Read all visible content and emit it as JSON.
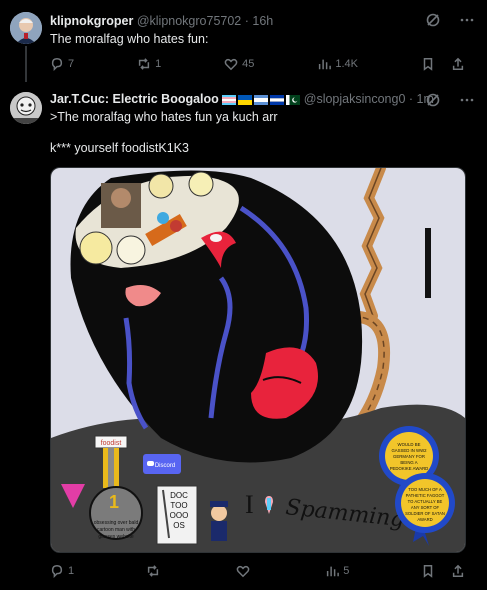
{
  "post1": {
    "name": "klipnokgroper",
    "handle": "@klipnokgro75702",
    "time": "16h",
    "text": "The moralfag who hates fun:",
    "replies": "7",
    "reposts": "1",
    "likes": "45",
    "views": "1.4K"
  },
  "post2": {
    "name": "Jar.T.Cuc: Electric Boogaloo",
    "handle": "@slopjaksincong0",
    "time": "1m",
    "line1": ">The moralfag who hates fun ya kuch arr",
    "line2": "k*** yourself foodistK1K3",
    "replies": "1",
    "reposts": "",
    "likes": "",
    "views": "5"
  },
  "image": {
    "label_foodist": "foodist",
    "label_discord": "Discord",
    "medal_text": "obsessing over bald cartoon man with glasses website",
    "medal_number": "1",
    "doc_text": "DOC TOO OOO OS",
    "spamming_text": "Spamming 'p",
    "i_text": "I",
    "rosette1": "WOULD BE GASSED IN WW2 GERMANY FOR BEING A PEDOKIKE AWARD",
    "rosette2": "TOO MUCH OF A PATHETIC FAGGOT TO ACTUALLY BE ANY SORT OF SOLDIER OF SATAN AWARD"
  },
  "colors": {
    "accent": "#1d9bf0",
    "muted": "#71767b",
    "bg": "#000000",
    "image_bg": "#dcdde8",
    "rope": "#c88a4a",
    "hood": "#0c0c0c",
    "red": "#e8233c",
    "blue": "#4a52c8"
  }
}
